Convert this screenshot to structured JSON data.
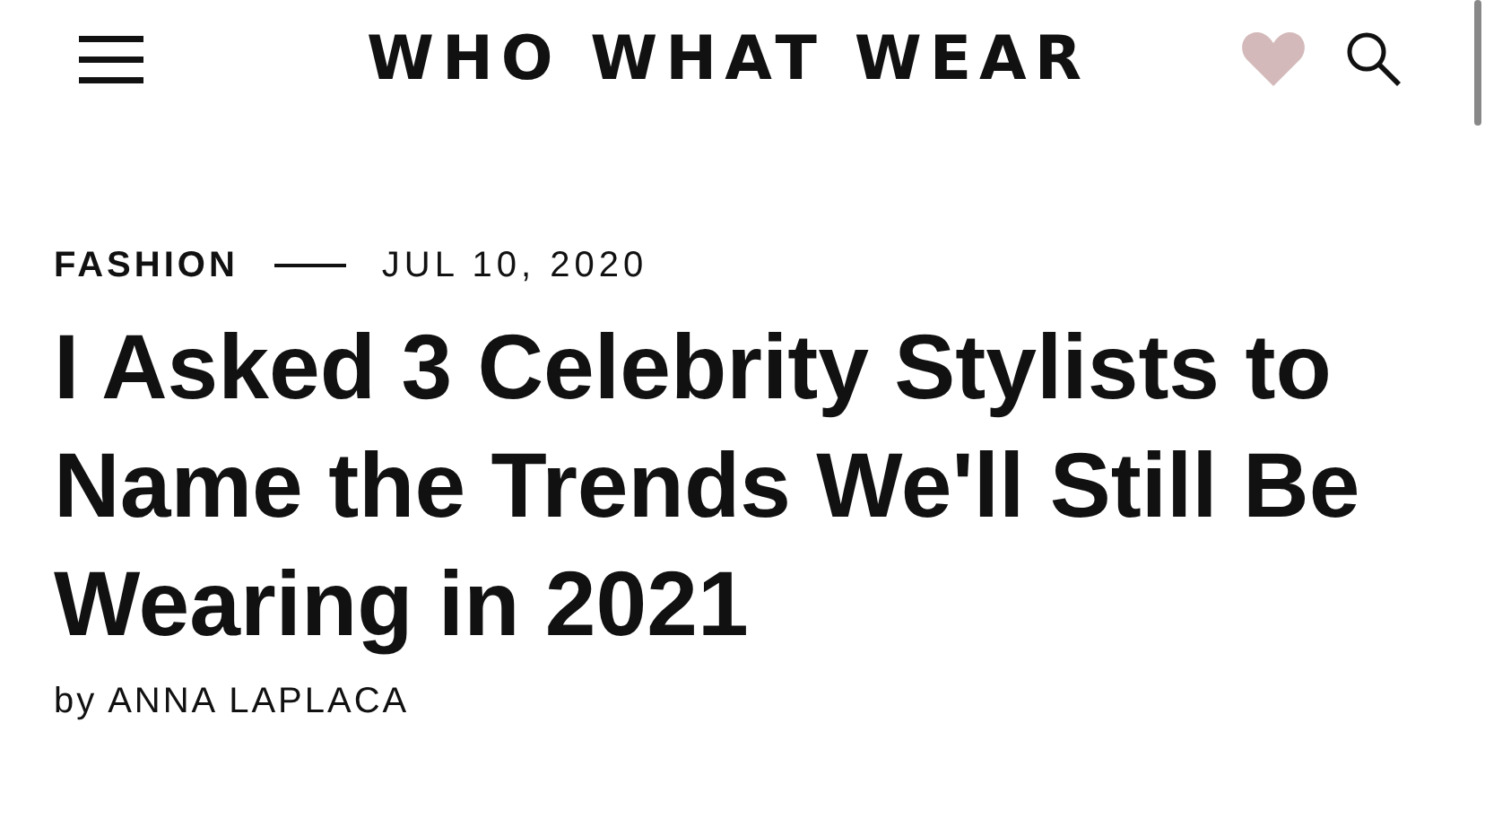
{
  "header": {
    "logo": "WHO WHAT WEAR"
  },
  "article": {
    "category": "FASHION",
    "date": "JUL 10, 2020",
    "title": "I Asked 3 Celebrity Stylists to Name the Trends We'll Still Be Wearing in 2021",
    "byline": "by ANNA LAPLACA"
  }
}
